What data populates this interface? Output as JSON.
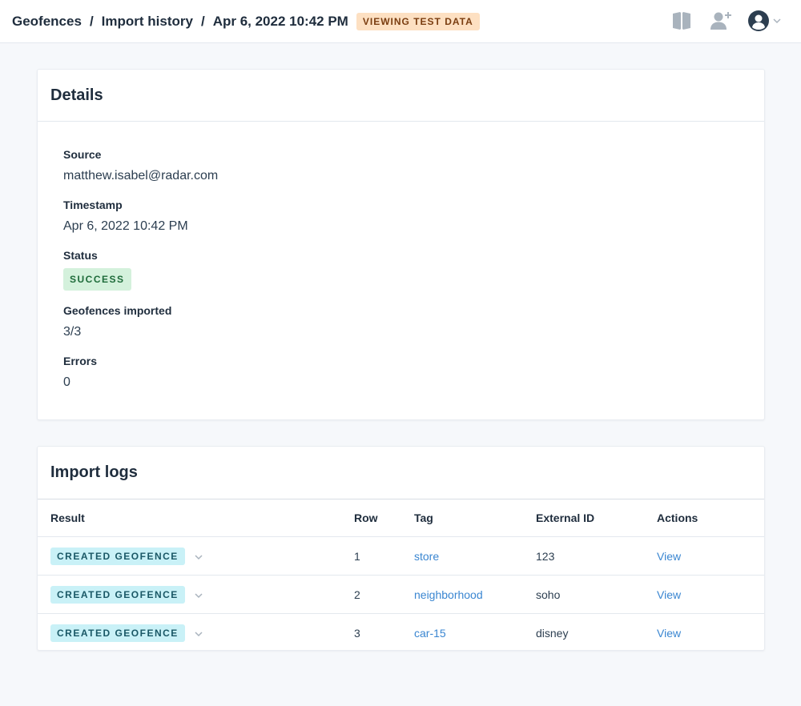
{
  "header": {
    "breadcrumbs": [
      "Geofences",
      "Import history",
      "Apr 6, 2022 10:42 PM"
    ],
    "separator": "/",
    "test_badge": "VIEWING TEST DATA",
    "icons": [
      "book-icon",
      "add-user-icon",
      "account-icon",
      "chevron-down-icon"
    ]
  },
  "details": {
    "title": "Details",
    "source_label": "Source",
    "source_value": "matthew.isabel@radar.com",
    "timestamp_label": "Timestamp",
    "timestamp_value": "Apr 6, 2022 10:42 PM",
    "status_label": "Status",
    "status_value": "SUCCESS",
    "imported_label": "Geofences imported",
    "imported_value": "3/3",
    "errors_label": "Errors",
    "errors_value": "0"
  },
  "logs": {
    "title": "Import logs",
    "columns": [
      "Result",
      "Row",
      "Tag",
      "External ID",
      "Actions"
    ],
    "rows": [
      {
        "result": "CREATED GEOFENCE",
        "row": "1",
        "tag": "store",
        "external_id": "123",
        "action": "View"
      },
      {
        "result": "CREATED GEOFENCE",
        "row": "2",
        "tag": "neighborhood",
        "external_id": "soho",
        "action": "View"
      },
      {
        "result": "CREATED GEOFENCE",
        "row": "3",
        "tag": "car-15",
        "external_id": "disney",
        "action": "View"
      }
    ]
  },
  "colors": {
    "test_badge_bg": "#fde0c2",
    "success_bg": "#d4f1dc",
    "created_bg": "#c9f1f7",
    "link": "#3a86d1"
  }
}
